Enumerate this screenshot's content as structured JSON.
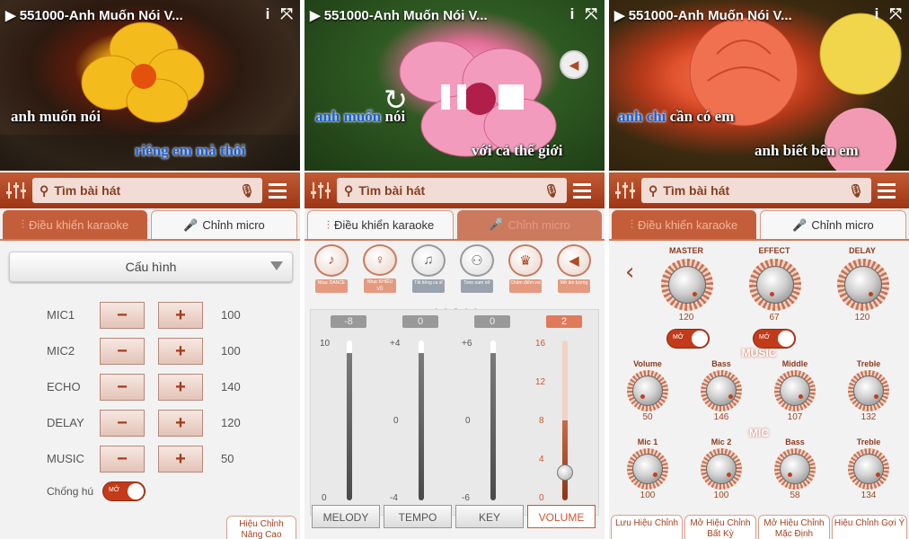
{
  "panels": [
    {
      "title": "551000-Anh Muốn Nói V...",
      "lyric1": "anh muốn nói",
      "lyric2": "riêng em mà thôi",
      "search": "Tìm bài hát",
      "tab1": "Điều khiển karaoke",
      "tab2": "Chỉnh micro"
    },
    {
      "title": "551000-Anh Muốn Nói V...",
      "lyric1a": "anh muốn",
      "lyric1b": " nói",
      "lyric2": "với cả thế giới",
      "search": "Tìm bài hát",
      "tab1": "Điều khiển karaoke",
      "tab2": "Chỉnh micro"
    },
    {
      "title": "551000-Anh Muốn Nói V...",
      "lyric1a": "anh chỉ",
      "lyric1b": " cần có em",
      "lyric2": "anh biết bên em",
      "search": "Tìm bài hát",
      "tab1": "Điều khiển karaoke",
      "tab2": "Chỉnh micro"
    }
  ],
  "mic": {
    "config_label": "Cấu hình",
    "rows": [
      {
        "label": "MIC1",
        "value": "100"
      },
      {
        "label": "MIC2",
        "value": "100"
      },
      {
        "label": "ECHO",
        "value": "140"
      },
      {
        "label": "DELAY",
        "value": "120"
      },
      {
        "label": "MUSIC",
        "value": "50"
      }
    ],
    "minus": "−",
    "plus": "+",
    "anti_howl_label": "Chống hú",
    "toggle_text": "MỞ",
    "advanced": "Hiệu Chỉnh Nâng Cao"
  },
  "karaoke": {
    "effects": [
      {
        "icon": "dance-icon",
        "label": "Nhạc DANCE",
        "glyph": "♪"
      },
      {
        "icon": "dance-move-icon",
        "label": "Nhạc KHIÊU VŨ",
        "glyph": "♀"
      },
      {
        "icon": "singer-mute-icon",
        "label": "Tắt tiếng ca sĩ",
        "glyph": "♫"
      },
      {
        "icon": "duet-icon",
        "label": "Tone nam nữ",
        "glyph": "⚇"
      },
      {
        "icon": "trophy-icon",
        "label": "Chấm điểm vui",
        "glyph": "♛"
      },
      {
        "icon": "speaker-icon",
        "label": "Mở âm lượng",
        "glyph": "◀"
      }
    ],
    "sliders": [
      {
        "name": "MELODY",
        "value": "-8",
        "ticks": [
          "10",
          "0"
        ]
      },
      {
        "name": "TEMPO",
        "value": "0",
        "ticks": [
          "+4",
          "0",
          "-4"
        ]
      },
      {
        "name": "KEY",
        "value": "0",
        "ticks": [
          "+6",
          "0",
          "-6"
        ]
      },
      {
        "name": "VOLUME",
        "value": "2",
        "ticks": [
          "16",
          "12",
          "8",
          "4",
          "0"
        ]
      }
    ]
  },
  "micro": {
    "top": [
      {
        "label": "MASTER",
        "value": "120"
      },
      {
        "label": "EFFECT",
        "value": "67"
      },
      {
        "label": "DELAY",
        "value": "120"
      }
    ],
    "toggle1": "MỞ",
    "toggle2": "MỞ",
    "music_label": "MUSIC",
    "music": [
      {
        "label": "Volume",
        "value": "50"
      },
      {
        "label": "Bass",
        "value": "146"
      },
      {
        "label": "Middle",
        "value": "107"
      },
      {
        "label": "Treble",
        "value": "132"
      }
    ],
    "mic_label": "MIC",
    "mic": [
      {
        "label": "Mic 1",
        "value": "100"
      },
      {
        "label": "Mic 2",
        "value": "100"
      },
      {
        "label": "Bass",
        "value": "58"
      },
      {
        "label": "Treble",
        "value": "134"
      }
    ],
    "bottom_tabs": [
      "Lưu Hiệu Chỉnh",
      "Mở Hiệu Chỉnh Bất Kỳ",
      "Mở Hiệu Chỉnh Mặc Định",
      "Hiệu Chỉnh Gợi Ý"
    ]
  },
  "colors": {
    "accent": "#c25a34",
    "tab_active": "#c45e3a"
  }
}
